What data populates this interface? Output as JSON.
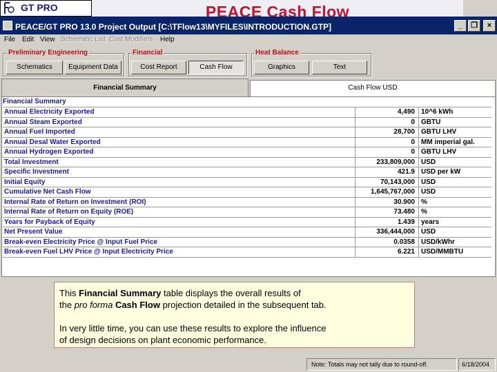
{
  "logo": {
    "text": "GT PRO"
  },
  "banner": {
    "title": "PEACE Cash Flow"
  },
  "window": {
    "title": "PEACE/GT PRO 13.0  Project Output [C:\\TFlow13\\MYFILES\\INTRODUCTION.GTP]"
  },
  "menu": [
    "File",
    "Edit",
    "View",
    "Schematic List",
    "Cost Modifiers",
    "Help"
  ],
  "groups": {
    "preliminary": {
      "label": "Preliminary Engineering",
      "buttons": [
        "Schematics",
        "Equipment Data"
      ]
    },
    "financial": {
      "label": "Financial",
      "buttons": [
        "Cost Report",
        "Cash Flow"
      ]
    },
    "heat_balance": {
      "label": "Heat Balance",
      "buttons": [
        "Graphics",
        "Text"
      ]
    }
  },
  "tabs": [
    "Financial Summary",
    "Cash Flow USD"
  ],
  "table": {
    "header": "Financial Summary",
    "rows": [
      {
        "label": "Annual Electricity Exported",
        "value": "4,490",
        "unit": "10^6 kWh"
      },
      {
        "label": "Annual Steam Exported",
        "value": "0",
        "unit": "GBTU"
      },
      {
        "label": "Annual Fuel Imported",
        "value": "28,700",
        "unit": "GBTU LHV"
      },
      {
        "label": "Annual Desal Water Exported",
        "value": "0",
        "unit": "MM imperial gal."
      },
      {
        "label": "Annual Hydrogen Exported",
        "value": "0",
        "unit": "GBTU LHV"
      },
      {
        "label": "Total Investment",
        "value": "233,809,000",
        "unit": "USD"
      },
      {
        "label": "Specific Investment",
        "value": "421.9",
        "unit": "USD per kW"
      },
      {
        "label": "Initial Equity",
        "value": "70,143,000",
        "unit": "USD"
      },
      {
        "label": "Cumulative Net Cash Flow",
        "value": "1,645,767,000",
        "unit": "USD"
      },
      {
        "label": "Internal Rate of Return on Investment (ROI)",
        "value": "30.900",
        "unit": "%"
      },
      {
        "label": "Internal Rate of Return on Equity (ROE)",
        "value": "73.480",
        "unit": "%"
      },
      {
        "label": "Years for Payback of Equity",
        "value": "1.439",
        "unit": "years"
      },
      {
        "label": "Net Present Value",
        "value": "336,444,000",
        "unit": "USD"
      },
      {
        "label": "Break-even Electricity Price @ Input Fuel Price",
        "value": "0.0358",
        "unit": " USD/kWhr"
      },
      {
        "label": "Break-even Fuel LHV Price @ Input Electricity Price",
        "value": "6.221",
        "unit": " USD/MMBTU"
      }
    ]
  },
  "note": {
    "line1_pre": "This ",
    "line1_bold": "Financial Summary",
    "line1_post": " table displays the overall results of",
    "line2_pre": "the ",
    "line2_italic": "pro forma",
    "line2_bold": " Cash Flow",
    "line2_post": " projection detailed in the subsequent tab.",
    "line3": "In very little time, you can use these results to explore the influence",
    "line4": "of design decisions on plant economic performance."
  },
  "status": {
    "note": "Note: Totals may not tally due to round-off.",
    "date": "6/18/2004"
  },
  "colors": {
    "accent": "#c8102e",
    "titlebar": "#0a246a",
    "label": "#1a1aa0"
  }
}
